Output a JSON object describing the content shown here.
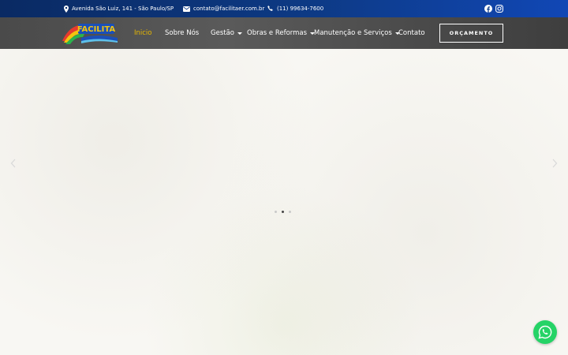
{
  "topbar": {
    "address": "Avenida São Luiz, 141 - São Paulo/SP",
    "email": "contato@facilitaer.com.br",
    "phone": "(11) 99634-7600",
    "icons": {
      "address": "map-pin-icon",
      "email": "envelope-icon",
      "phone": "phone-icon",
      "facebook": "facebook-icon",
      "instagram": "instagram-icon"
    }
  },
  "navbar": {
    "logo_text": "FACILITA",
    "items": [
      {
        "label": "Inicio",
        "active": true
      },
      {
        "label": "Sobre Nós"
      },
      {
        "label": "Gestão",
        "dropdown": true
      },
      {
        "label": "Obras e Reformas",
        "dropdown": true
      },
      {
        "label": "Manutenção e Serviços",
        "dropdown": true
      },
      {
        "label": "Contato"
      }
    ],
    "cta_label": "ORÇAMENTO"
  },
  "slider": {
    "dots": 3,
    "active_dot": 2
  },
  "colors": {
    "topbar": "#0d3a85",
    "navbar": "#4a4a4a",
    "active_nav": "#e8b800",
    "whatsapp": "#25d366"
  }
}
